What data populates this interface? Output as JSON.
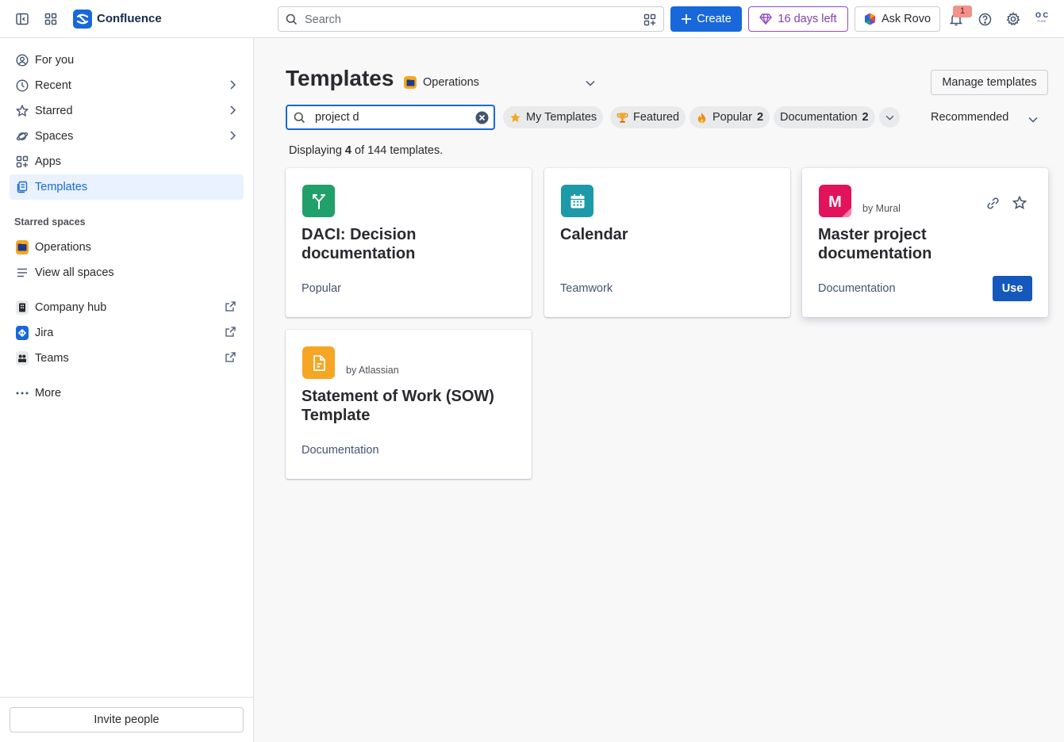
{
  "topbar": {
    "brand": "Confluence",
    "search_placeholder": "Search",
    "create_label": "Create",
    "trial_label": "16 days left",
    "rovo_label": "Ask Rovo",
    "notification_count": "1",
    "avatar_initials_top": "O C",
    "avatar_initials_bottom": "PURE",
    "icons": [
      "sidebar-toggle-icon",
      "app-switcher-icon",
      "confluence-logo",
      "search-icon",
      "search-filter-icon",
      "plus-icon",
      "diamond-icon",
      "rovo-icon",
      "bell-icon",
      "help-icon",
      "settings-icon"
    ],
    "colors": {
      "brand_blue": "#1868db",
      "trial_purple": "#803fa5"
    }
  },
  "sidebar": {
    "items": [
      {
        "label": "For you",
        "icon": "person-circle-icon"
      },
      {
        "label": "Recent",
        "icon": "clock-icon"
      },
      {
        "label": "Starred",
        "icon": "star-icon"
      },
      {
        "label": "Spaces",
        "icon": "planet-icon"
      },
      {
        "label": "Apps",
        "icon": "apps-icon"
      },
      {
        "label": "Templates",
        "icon": "template-icon",
        "active": true
      }
    ],
    "starred_spaces_label": "Starred spaces",
    "spaces": [
      {
        "label": "Operations",
        "icon": "operations-space-icon"
      },
      {
        "label": "View all spaces",
        "icon": "list-icon"
      }
    ],
    "external": [
      {
        "label": "Company hub",
        "icon": "building-icon"
      },
      {
        "label": "Jira",
        "icon": "jira-icon"
      },
      {
        "label": "Teams",
        "icon": "teams-icon"
      }
    ],
    "more_label": "More",
    "invite_label": "Invite people"
  },
  "main": {
    "title": "Templates",
    "space_selector": "Operations",
    "manage_label": "Manage templates",
    "search_value": "project d",
    "chips": [
      {
        "label": "My Templates",
        "count": "",
        "icon": "star-icon"
      },
      {
        "label": "Featured",
        "count": "",
        "icon": "trophy-icon"
      },
      {
        "label": "Popular",
        "count": "2",
        "icon": "fire-icon"
      },
      {
        "label": "Documentation",
        "count": "2",
        "icon": ""
      }
    ],
    "sort_label": "Recommended",
    "count_prefix": "Displaying ",
    "count_shown": "4",
    "count_suffix": " of 144 templates.",
    "cards": [
      {
        "title": "DACI: Decision documentation",
        "category": "Popular",
        "by": "",
        "icon": "daci-icon",
        "color": "#22a06b"
      },
      {
        "title": "Calendar",
        "category": "Teamwork",
        "by": "",
        "icon": "calendar-icon",
        "color": "#1d9aaa"
      },
      {
        "title": "Master project documentation",
        "category": "Documentation",
        "by": "by Mural",
        "icon": "mural-icon",
        "color": "#e2125b",
        "use_label": "Use"
      },
      {
        "title": "Statement of Work (SOW) Template",
        "category": "Documentation",
        "by": "by Atlassian",
        "icon": "document-icon",
        "color": "#f5a623"
      }
    ]
  }
}
